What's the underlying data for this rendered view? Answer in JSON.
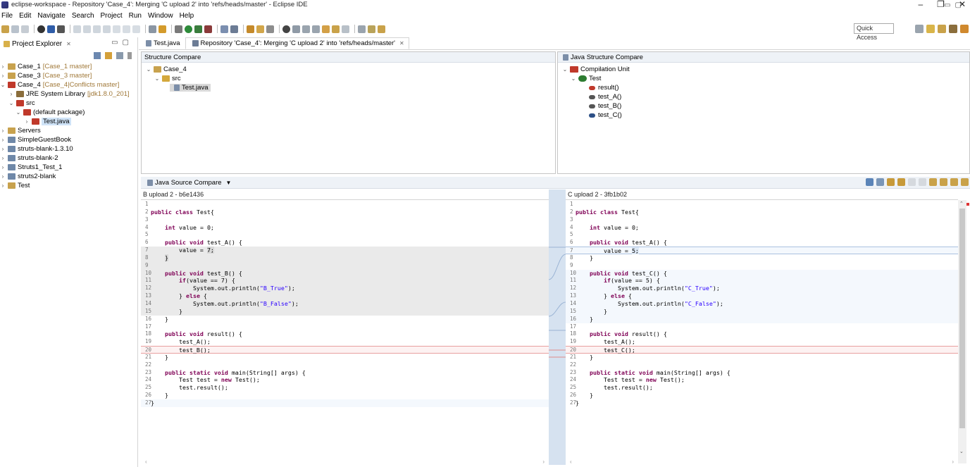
{
  "window": {
    "title": "eclipse-workspace - Repository 'Case_4': Merging 'C upload 2' into 'refs/heads/master' - Eclipse IDE",
    "controls": [
      "–",
      "❐",
      "✕"
    ]
  },
  "menu": [
    "File",
    "Edit",
    "Navigate",
    "Search",
    "Project",
    "Run",
    "Window",
    "Help"
  ],
  "toolbar": {
    "quick_access": "Quick Access"
  },
  "project_explorer": {
    "title": "Project Explorer",
    "items": [
      {
        "label": "Case_1",
        "deco": "[Case_1 master]"
      },
      {
        "label": "Case_3",
        "deco": "[Case_3 master]"
      },
      {
        "label": "Case_4",
        "deco": "[Case_4|Conflicts master]"
      },
      {
        "label": "JRE System Library",
        "deco": "[jdk1.8.0_201]"
      },
      {
        "label": "src",
        "deco": ""
      },
      {
        "label": "(default package)",
        "deco": ""
      },
      {
        "label": "Test.java",
        "deco": ""
      },
      {
        "label": "Servers",
        "deco": ""
      },
      {
        "label": "SimpleGuestBook",
        "deco": ""
      },
      {
        "label": "struts-blank-1.3.10",
        "deco": ""
      },
      {
        "label": "struts-blank-2",
        "deco": ""
      },
      {
        "label": "Struts1_Test_1",
        "deco": ""
      },
      {
        "label": "struts2-blank",
        "deco": ""
      },
      {
        "label": "Test",
        "deco": ""
      }
    ]
  },
  "editor_tabs": [
    {
      "label": "Test.java"
    },
    {
      "label": "Repository 'Case_4': Merging 'C upload 2' into 'refs/heads/master'"
    }
  ],
  "structure_compare": {
    "title": "Structure Compare",
    "items": [
      "Case_4",
      "src",
      "Test.java"
    ]
  },
  "java_structure_compare": {
    "title": "Java Structure Compare",
    "items": [
      "Compilation Unit",
      "Test",
      "result()",
      "test_A()",
      "test_B()",
      "test_C()"
    ]
  },
  "source_compare": {
    "title": "Java Source Compare"
  },
  "left": {
    "label": "B upload 2 - b6e1436",
    "lines": [
      "1",
      "2",
      "3",
      "4",
      "5",
      "6",
      "7",
      "8",
      "9",
      "10",
      "11",
      "12",
      "13",
      "14",
      "15",
      "16",
      "17",
      "18",
      "19",
      "20",
      "21",
      "22",
      "23",
      "24",
      "25",
      "26",
      "27"
    ]
  },
  "right": {
    "label": "C upload 2 - 3fb1b02"
  }
}
